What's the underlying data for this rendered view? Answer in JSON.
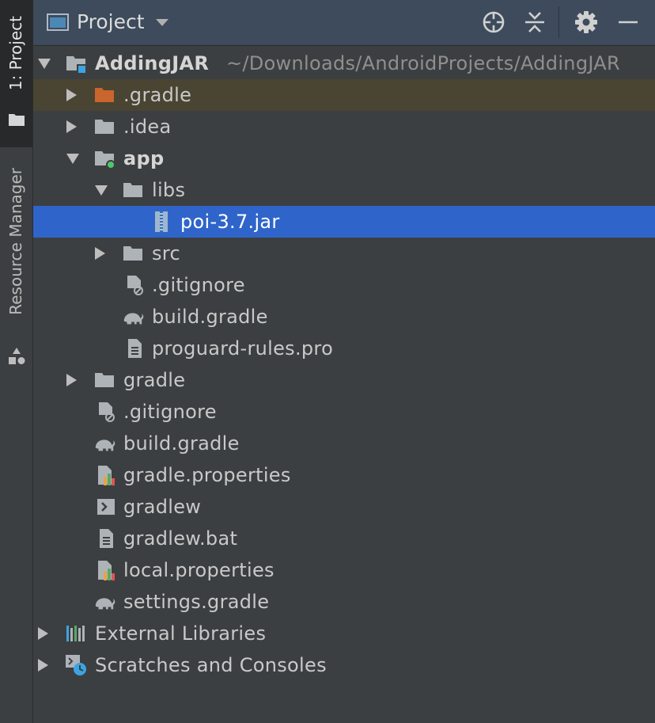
{
  "sidebar": {
    "project_tab": "1: Project",
    "resource_tab": "Resource Manager"
  },
  "header": {
    "title": "Project",
    "icons": [
      "locate-icon",
      "collapse-all-icon",
      "gear-icon",
      "minimize-icon"
    ]
  },
  "tree": {
    "root_name": "AddingJAR",
    "root_path": "~/Downloads/AndroidProjects/AddingJAR",
    "items": [
      {
        "label": ".gradle",
        "icon": "folder-excluded-icon"
      },
      {
        "label": ".idea",
        "icon": "folder-icon"
      },
      {
        "label": "app",
        "icon": "module-folder-icon"
      },
      {
        "label": "libs",
        "icon": "folder-icon"
      },
      {
        "label": "poi-3.7.jar",
        "icon": "jar-icon"
      },
      {
        "label": "src",
        "icon": "folder-icon"
      },
      {
        "label": ".gitignore",
        "icon": "ignored-file-icon"
      },
      {
        "label": "build.gradle",
        "icon": "gradle-icon"
      },
      {
        "label": "proguard-rules.pro",
        "icon": "text-file-icon"
      },
      {
        "label": "gradle",
        "icon": "folder-icon"
      },
      {
        "label": ".gitignore",
        "icon": "ignored-file-icon"
      },
      {
        "label": "build.gradle",
        "icon": "gradle-icon"
      },
      {
        "label": "gradle.properties",
        "icon": "properties-file-icon"
      },
      {
        "label": "gradlew",
        "icon": "shell-script-icon"
      },
      {
        "label": "gradlew.bat",
        "icon": "text-file-icon"
      },
      {
        "label": "local.properties",
        "icon": "properties-file-icon"
      },
      {
        "label": "settings.gradle",
        "icon": "gradle-icon"
      },
      {
        "label": "External Libraries",
        "icon": "libraries-icon"
      },
      {
        "label": "Scratches and Consoles",
        "icon": "scratches-icon"
      }
    ]
  },
  "colors": {
    "background": "#3c3f41",
    "header": "#3d4b5c",
    "selection": "#2f65ca",
    "excluded_row": "#4a4433"
  }
}
